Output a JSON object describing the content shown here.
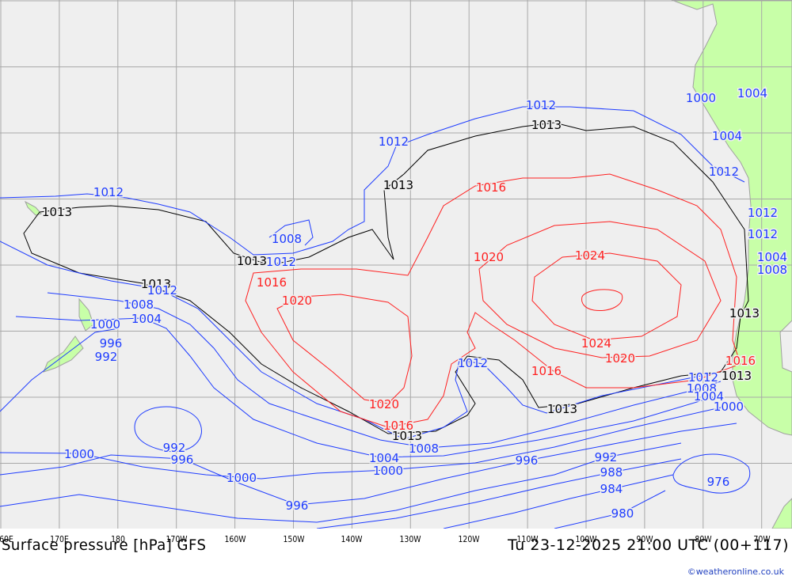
{
  "title": "Surface pressure [hPa] GFS",
  "valid_time": "Tu 23-12-2025 21:00 UTC (00+117)",
  "credit": "©weatheronline.co.uk",
  "longitude_ticks": [
    "60E",
    "170E",
    "180",
    "170W",
    "160W",
    "150W",
    "140W",
    "130W",
    "120W",
    "110W",
    "100W",
    "90W",
    "80W",
    "70W"
  ],
  "colors": {
    "ocean": "#efefef",
    "land": "#c8ffa8",
    "grid": "#a8a8a8",
    "low_isobar": "#1e3cff",
    "mean_isobar": "#000000",
    "high_isobar": "#ff2020"
  },
  "isobar_labels": {
    "black": [
      "1013",
      "1013",
      "1013",
      "1013",
      "1013",
      "1013",
      "1013",
      "1013",
      "1013"
    ],
    "blue": [
      "1012",
      "1012",
      "1012",
      "1012",
      "1012",
      "1012",
      "1012",
      "1012",
      "1012",
      "1012",
      "1008",
      "1008",
      "1008",
      "1008",
      "1004",
      "1004",
      "1004",
      "1004",
      "1004",
      "1000",
      "1000",
      "1000",
      "1000",
      "1000",
      "996",
      "996",
      "996",
      "996",
      "992",
      "992",
      "992",
      "988",
      "984",
      "980",
      "976",
      "1004",
      "1008",
      "1000"
    ],
    "red": [
      "1016",
      "1016",
      "1016",
      "1016",
      "1016",
      "1020",
      "1020",
      "1020",
      "1020",
      "1024",
      "1024"
    ]
  }
}
